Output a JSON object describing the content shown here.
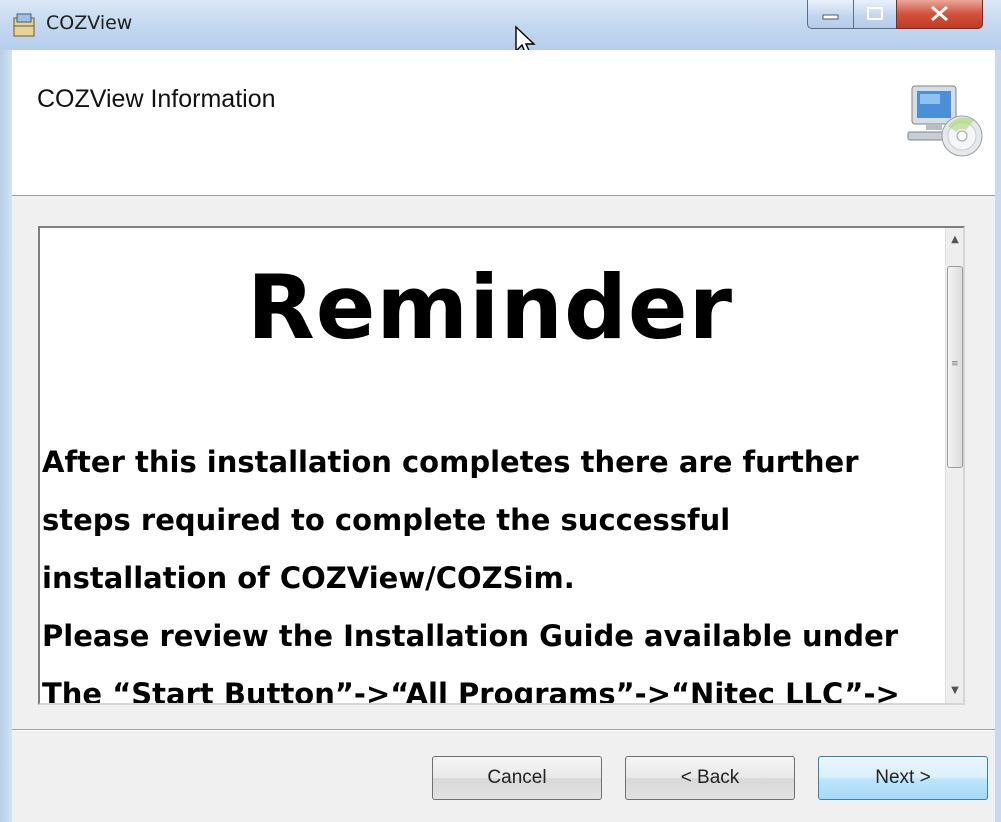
{
  "window": {
    "title": "COZView"
  },
  "header": {
    "title": "COZView Information",
    "icon": "computer-with-cd-icon"
  },
  "content": {
    "heading": "Reminder",
    "lines": [
      "After this installation completes there are further",
      "steps required to complete the successful",
      "installation of COZView/COZSim.",
      "Please review the Installation Guide available under",
      "The “Start Button”->“All Programs”->“Nitec LLC”->"
    ]
  },
  "buttons": {
    "cancel": "Cancel",
    "back": "< Back",
    "next": "Next >"
  },
  "colors": {
    "titlebar": "#c6d9f0",
    "close_button": "#c13a22",
    "default_button": "#bee6fd"
  }
}
